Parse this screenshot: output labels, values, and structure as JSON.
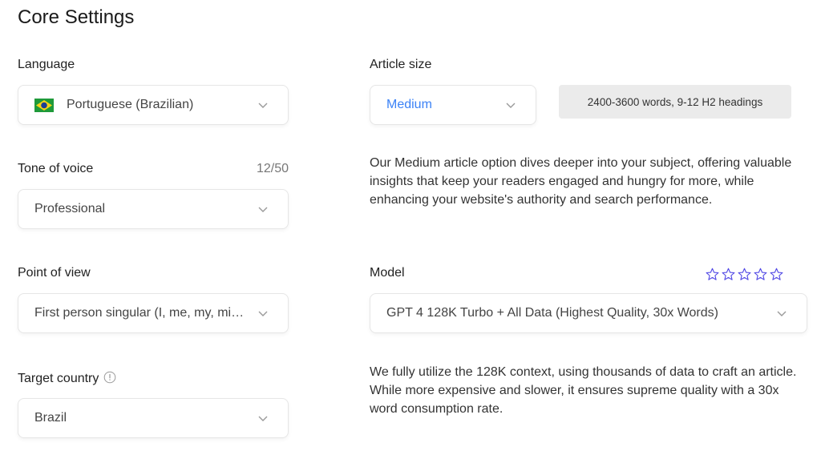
{
  "page": {
    "title": "Core Settings"
  },
  "language": {
    "label": "Language",
    "value": "Portuguese (Brazilian)",
    "flag_icon": "brazil-flag-icon"
  },
  "article_size": {
    "label": "Article size",
    "value": "Medium",
    "value_color": "#3b82f6",
    "info": "2400-3600 words, 9-12 H2 headings",
    "description": "Our Medium article option dives deeper into your subject, offering valuable insights that keep your readers engaged and hungry for more, while enhancing your website's authority and search performance."
  },
  "tone_of_voice": {
    "label": "Tone of voice",
    "counter": "12/50",
    "value": "Professional"
  },
  "point_of_view": {
    "label": "Point of view",
    "value": "First person singular (I, me, my, mine)"
  },
  "model": {
    "label": "Model",
    "value": "GPT 4 128K Turbo + All Data (Highest Quality, 30x Words)",
    "rating": {
      "filled": 0,
      "max": 5,
      "color": "#4f46e5"
    },
    "description": "We fully utilize the 128K context, using thousands of data to craft an article. While more expensive and slower, it ensures supreme quality with a 30x word consumption rate."
  },
  "target_country": {
    "label": "Target country",
    "info_icon": "info-circle-icon",
    "value": "Brazil"
  }
}
